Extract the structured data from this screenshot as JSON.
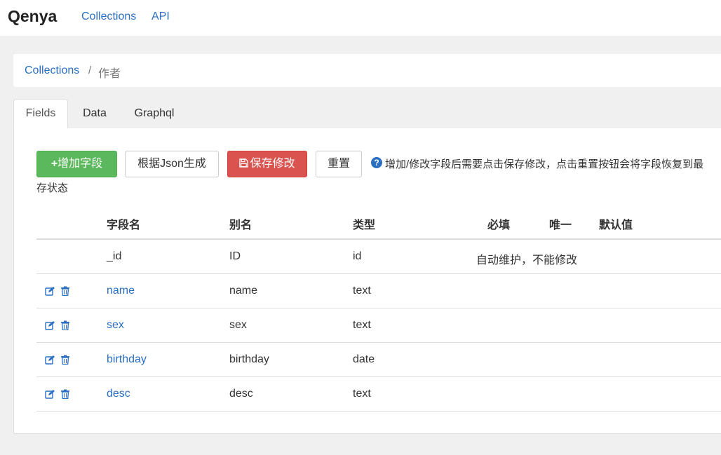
{
  "nav": {
    "brand": "Qenya",
    "links": [
      "Collections",
      "API"
    ]
  },
  "breadcrumb": {
    "parent": "Collections",
    "separator": "/",
    "current": "作者"
  },
  "tabs": [
    {
      "label": "Fields",
      "active": true
    },
    {
      "label": "Data",
      "active": false
    },
    {
      "label": "Graphql",
      "active": false
    }
  ],
  "toolbar": {
    "add_label": "增加字段",
    "add_icon": "plus-icon",
    "json_label": "根据Json生成",
    "save_label": "保存修改",
    "save_icon": "floppy-disk-icon",
    "reset_label": "重置"
  },
  "help": {
    "icon": "question-circle-icon",
    "line1": "增加/修改字段后需要点击保存修改，点击重置按钮会将字段恢复到最",
    "line2": "存状态"
  },
  "table": {
    "headers": [
      "字段名",
      "别名",
      "类型",
      "必填",
      "唯一",
      "默认值"
    ],
    "system_row": {
      "name": "_id",
      "alias": "ID",
      "type": "id",
      "note": "自动维护，不能修改"
    },
    "rows": [
      {
        "name": "name",
        "alias": "name",
        "type": "text"
      },
      {
        "name": "sex",
        "alias": "sex",
        "type": "text"
      },
      {
        "name": "birthday",
        "alias": "birthday",
        "type": "date"
      },
      {
        "name": "desc",
        "alias": "desc",
        "type": "text"
      }
    ],
    "row_actions": [
      "edit-icon",
      "trash-icon"
    ]
  },
  "colors": {
    "link": "#2a6fc3",
    "success": "#5cb85c",
    "danger": "#d9534f"
  }
}
